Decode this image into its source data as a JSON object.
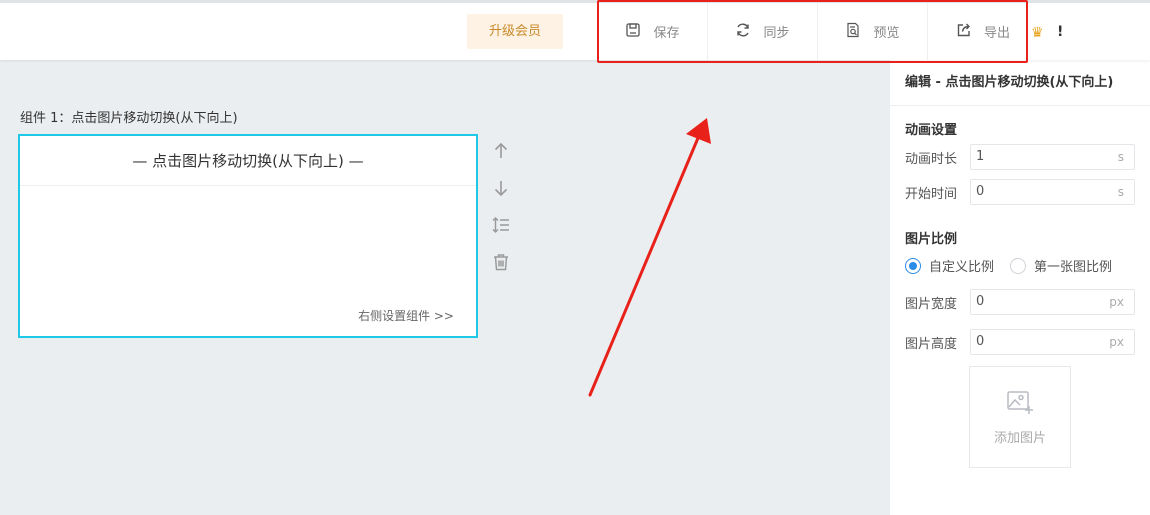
{
  "header": {
    "upgrade_label": "升级会员",
    "toolbar": [
      {
        "label": "保存",
        "icon": "save-icon"
      },
      {
        "label": "同步",
        "icon": "sync-icon"
      },
      {
        "label": "预览",
        "icon": "preview-icon"
      },
      {
        "label": "导出",
        "icon": "export-icon"
      }
    ],
    "crown_icon": "crown-icon",
    "alert_text": "!"
  },
  "workspace": {
    "component_title": "组件 1：点击图片移动切换(从下向上)",
    "card_header": "— 点击图片移动切换(从下向上) —",
    "card_footer": "右侧设置组件 >>",
    "side_tools": [
      "move-up-icon",
      "move-down-icon",
      "reorder-icon",
      "delete-icon"
    ]
  },
  "panel": {
    "title": "编辑 - 点击图片移动切换(从下向上)",
    "animation": {
      "section": "动画设置",
      "duration_label": "动画时长",
      "duration_value": "1",
      "duration_unit": "s",
      "start_label": "开始时间",
      "start_value": "0",
      "start_unit": "s"
    },
    "ratio": {
      "section": "图片比例",
      "option_custom": "自定义比例",
      "option_first": "第一张图比例",
      "selected": "自定义比例",
      "width_label": "图片宽度",
      "width_value": "0",
      "width_unit": "px",
      "height_label": "图片高度",
      "height_value": "0",
      "height_unit": "px"
    },
    "add_image_label": "添加图片"
  },
  "colors": {
    "highlight": "#e8211a",
    "accent": "#2b8be8",
    "card_border": "#1ec8e6",
    "upgrade_bg": "#fdf2e3",
    "upgrade_text": "#c98a2c"
  }
}
